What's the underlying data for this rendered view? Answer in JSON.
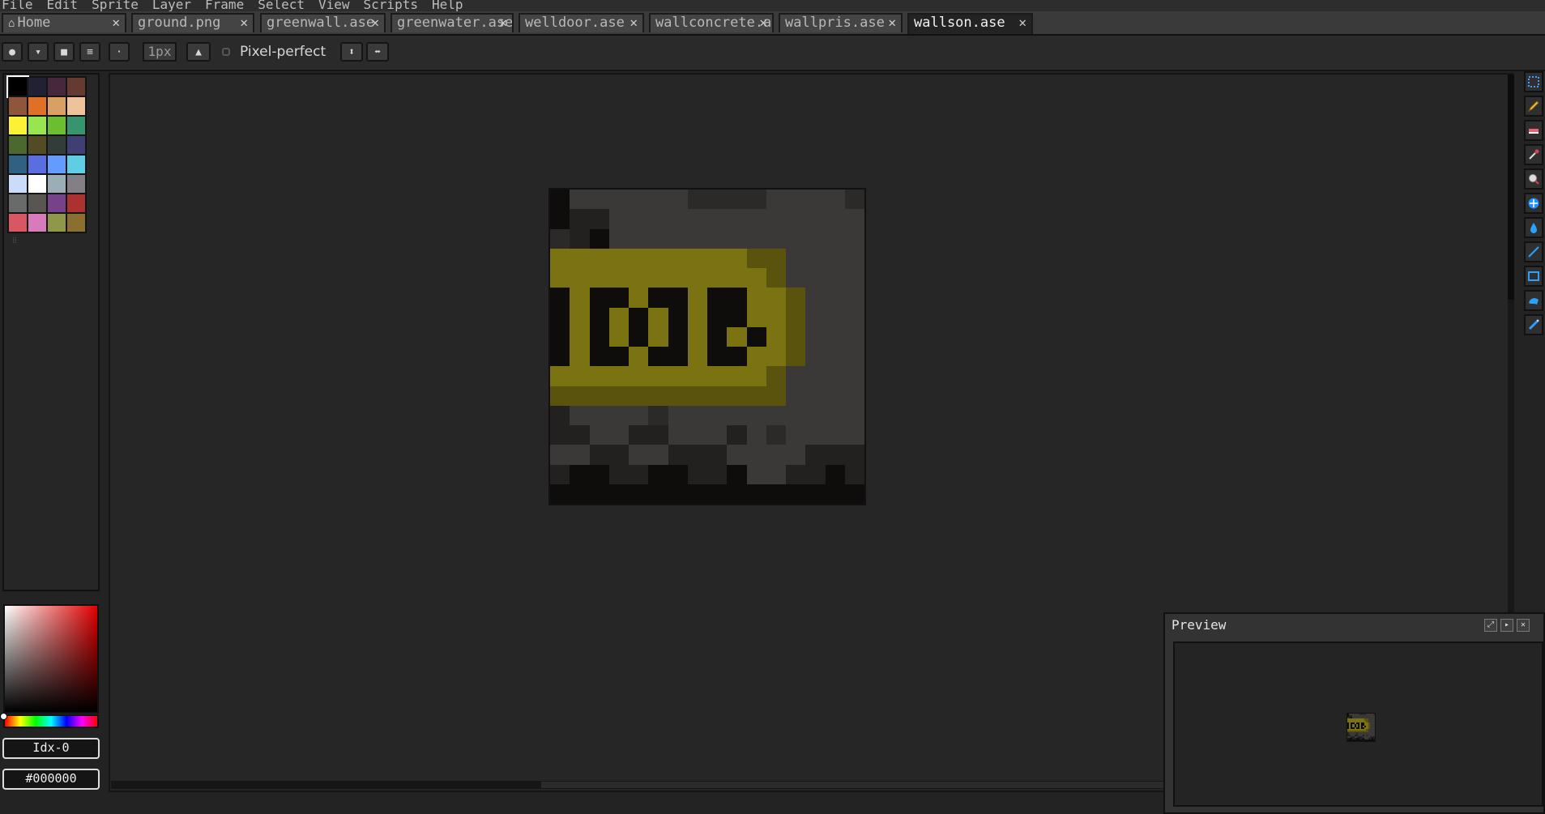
{
  "menu": [
    "File",
    "Edit",
    "Sprite",
    "Layer",
    "Frame",
    "Select",
    "View",
    "Scripts",
    "Help"
  ],
  "tabs": [
    {
      "label": "Home",
      "icon": "home-icon"
    },
    {
      "label": "ground.png"
    },
    {
      "label": "greenwall.ase"
    },
    {
      "label": "greenwater.ase"
    },
    {
      "label": "welldoor.ase"
    },
    {
      "label": "wallconcrete.a"
    },
    {
      "label": "wallpris.ase"
    },
    {
      "label": "wallson.ase",
      "active": true
    }
  ],
  "close_glyph": "✕",
  "toolbar": {
    "brush_size": "1px",
    "pixel_perfect_label": "Pixel-perfect",
    "pixel_perfect_checked": false
  },
  "palette": [
    "#000000",
    "#222034",
    "#45283c",
    "#663931",
    "#8f563b",
    "#df7126",
    "#d9a066",
    "#eec39a",
    "#fbf236",
    "#99e550",
    "#6abe30",
    "#37946e",
    "#4b692f",
    "#524b24",
    "#323c39",
    "#3f3f74",
    "#306082",
    "#5b6ee1",
    "#639bff",
    "#5fcde4",
    "#cbdbfc",
    "#ffffff",
    "#9badb7",
    "#847e87",
    "#696a6a",
    "#595652",
    "#76428a",
    "#ac3232",
    "#d95763",
    "#d77bba",
    "#8f974a",
    "#8a6f30"
  ],
  "color": {
    "index_label": "Idx-0",
    "hex_label": "#000000"
  },
  "preview": {
    "title": "Preview"
  },
  "sprite": {
    "name": "wallson.ase",
    "pixels": [
      "K4444443333444433",
      "K5544444444444444",
      "35K4444444444444",
      "YYYYYYYYYYGG4444",
      "YYYYYYYYYYYG4444",
      "KYKKYKKYKKYYG444",
      "KYKYKYKYKKYYG444",
      "KYKYKYKYKYKYG444",
      "KYKKYKKYKKYYG444",
      "YYYYYYYYYYYG4444",
      "GGGGGGGGGGGG4444",
      "5444434444444444",
      "5544554445434444",
      "4455445554444555",
      "5KK55KK55K4455K5",
      "KKKKKKKKKKKKKKKK"
    ]
  }
}
